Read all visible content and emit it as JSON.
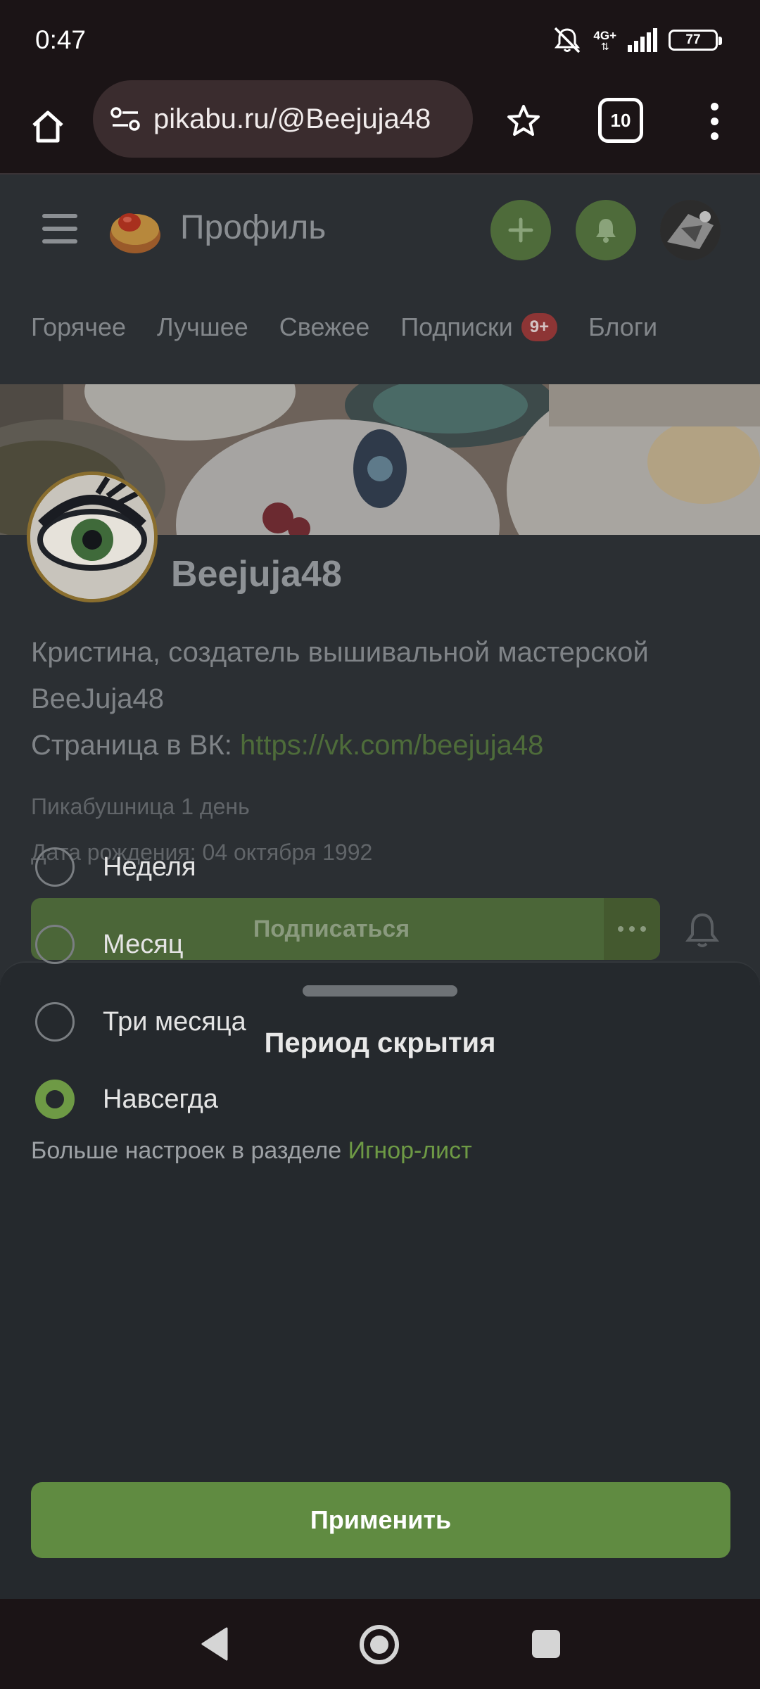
{
  "status": {
    "time": "0:47",
    "network": "4G+",
    "battery": "77"
  },
  "browser": {
    "url": "pikabu.ru/@Beejuja48",
    "tab_count": "10"
  },
  "header": {
    "title": "Профиль"
  },
  "nav": {
    "tabs": [
      {
        "label": "Горячее"
      },
      {
        "label": "Лучшее"
      },
      {
        "label": "Свежее"
      },
      {
        "label": "Подписки",
        "badge": "9+"
      },
      {
        "label": "Блоги"
      }
    ]
  },
  "profile": {
    "name": "Beejuja48",
    "bio_line1": "Кристина, создатель вышивальной мастерской BeeJuja48",
    "bio_vk_prefix": "Страница в ВК: ",
    "bio_vk_link": "https://vk.com/beejuja48",
    "membership": "Пикабушница 1 день",
    "birthday": "Дата рождения: 04 октября 1992",
    "subscribe_label": "Подписаться"
  },
  "sheet": {
    "title": "Период скрытия",
    "options": [
      {
        "label": "Неделя",
        "selected": false
      },
      {
        "label": "Месяц",
        "selected": false
      },
      {
        "label": "Три месяца",
        "selected": false
      },
      {
        "label": "Навсегда",
        "selected": true
      }
    ],
    "more_prefix": "Больше настроек в разделе ",
    "more_link": "Игнор-лист",
    "apply_label": "Применить"
  },
  "colors": {
    "accent_green": "#608b41",
    "sheet_bg": "#25292d",
    "badge_red": "#8d3535"
  }
}
